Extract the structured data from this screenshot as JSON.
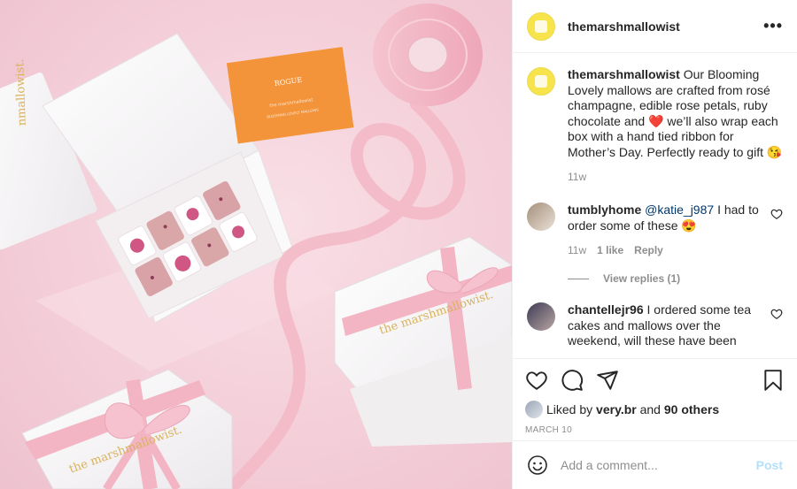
{
  "post": {
    "username": "themarshmallowist",
    "more_label": "•••"
  },
  "photo": {
    "box_brand": "the marshmallowist.",
    "card_title": "ROGUE",
    "card_line1": "the marshmallowist",
    "card_line2": "BLOOMING LOVELY MALLOWS",
    "colors": {
      "background": "#f4cfd9",
      "ribbon": "#f3b7c6",
      "card": "#f4943a",
      "gold": "#d8b25d"
    }
  },
  "caption": {
    "username": "themarshmallowist",
    "text": "Our Blooming Lovely mallows are crafted from rosé champagne, edible rose petals, ruby chocolate and ❤️ we’ll also wrap each box with a hand tied ribbon for Mother’s Day. Perfectly ready to gift 😘",
    "time": "11w"
  },
  "comments": [
    {
      "username": "tumblyhome",
      "mention": "@katie_j987",
      "text": "I had to order some of these 😍",
      "time": "11w",
      "likes": "1 like",
      "reply_label": "Reply",
      "view_replies": "View replies (1)"
    },
    {
      "username": "chantellejr96",
      "text": "I ordered some tea cakes and mallows over the weekend, will these have been"
    }
  ],
  "likes": {
    "prefix": "Liked by",
    "user": "very.br",
    "and": "and",
    "others": "90 others"
  },
  "date": "MARCH 10",
  "comment_box": {
    "placeholder": "Add a comment...",
    "post_label": "Post"
  },
  "icons": [
    "more-icon",
    "heart-icon",
    "comment-icon",
    "share-icon",
    "save-icon",
    "emoji-icon"
  ]
}
